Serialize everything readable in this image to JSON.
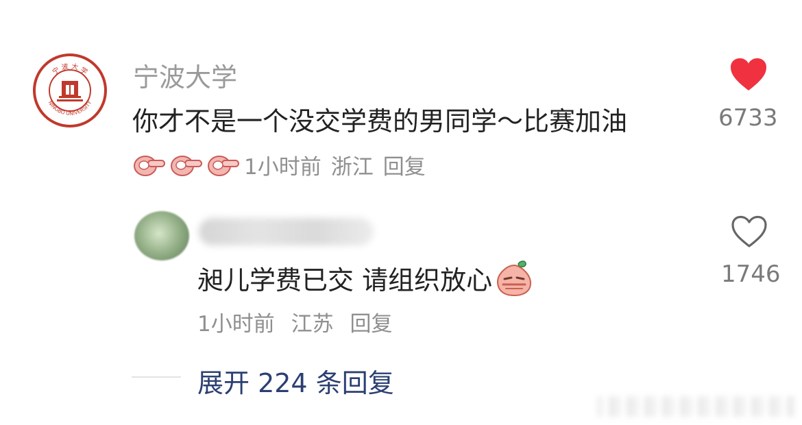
{
  "comment": {
    "author": "宁波大学",
    "avatar_seal_text": "宁波大学",
    "avatar_seal_subtext": "NINGBO UNIVERSITY",
    "text": "你才不是一个没交学费的男同学～比赛加油",
    "time": "1小时前",
    "location": "浙江",
    "reply_label": "回复",
    "likes": "6733",
    "liked": true,
    "emoji_names": [
      "pointing-hand-emoji",
      "pointing-hand-emoji",
      "pointing-hand-emoji"
    ]
  },
  "reply": {
    "text": "昶儿学费已交 请组织放心",
    "time": "1小时前",
    "location": "江苏",
    "reply_label": "回复",
    "likes": "1746",
    "liked": false,
    "emoji_name": "smirking-radish-emoji"
  },
  "expand": {
    "label": "展开 224 条回复"
  },
  "colors": {
    "accent_blue": "#2c3f72",
    "like_red": "#f0313f",
    "secondary_text": "#8f8f8f",
    "seal_red": "#c0392b"
  }
}
